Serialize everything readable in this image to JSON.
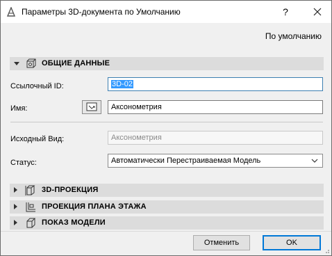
{
  "window": {
    "title": "Параметры 3D-документа по Умолчанию",
    "help_label": "?"
  },
  "preset_label": "По умолчанию",
  "sections": {
    "general": "ОБЩИЕ ДАННЫЕ",
    "projection": "3D-ПРОЕКЦИЯ",
    "floor_plan": "ПРОЕКЦИЯ ПЛАНА ЭТАЖА",
    "model_display": "ПОКАЗ МОДЕЛИ"
  },
  "form": {
    "ref_id_label": "Ссылочный ID:",
    "ref_id_value": "3D-02",
    "name_label": "Имя:",
    "name_value": "Аксонометрия",
    "source_view_label": "Исходный Вид:",
    "source_view_value": "Аксонометрия",
    "status_label": "Статус:",
    "status_value": "Автоматически Перестраиваемая Модель"
  },
  "buttons": {
    "cancel": "Отменить",
    "ok": "OK"
  },
  "colors": {
    "accent": "#0078d7",
    "selection": "#3399ff",
    "section_bg": "#dcdcdc"
  }
}
